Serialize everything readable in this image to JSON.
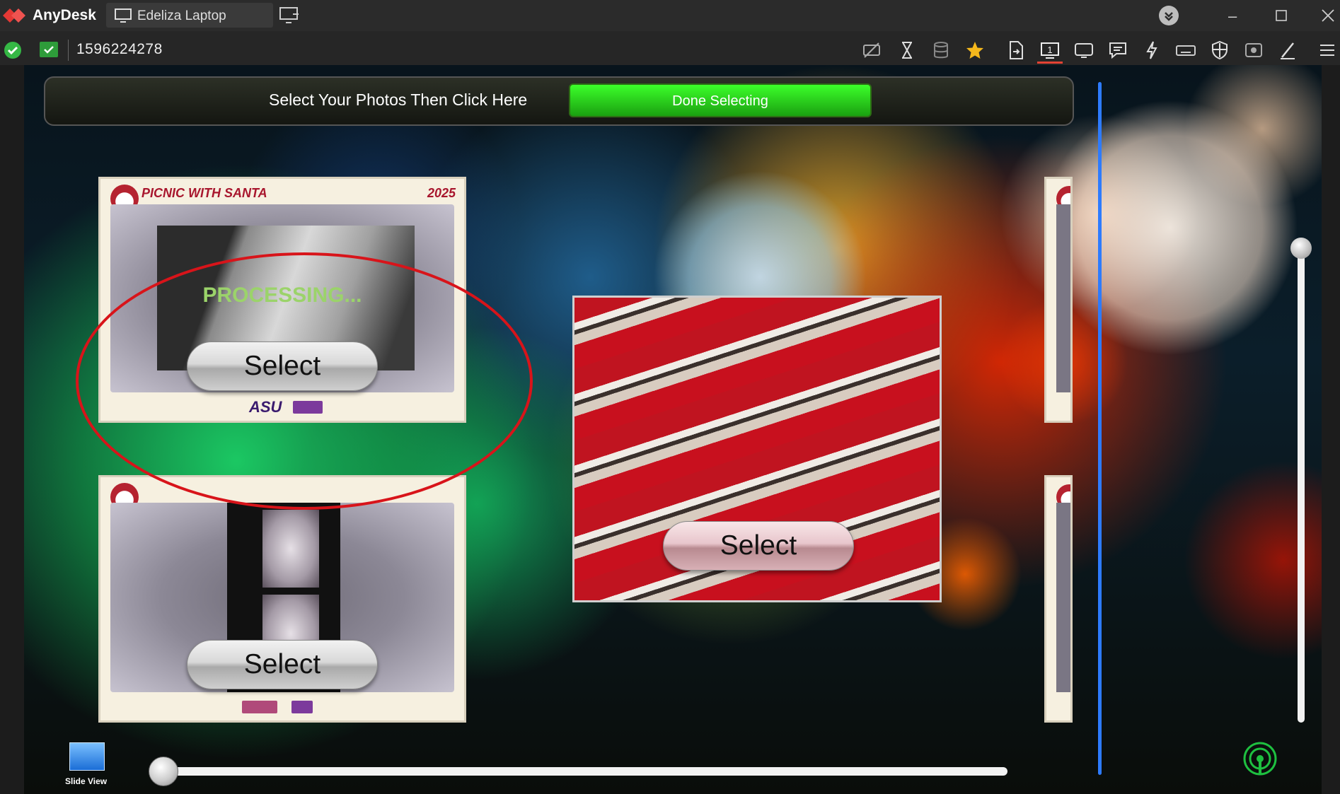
{
  "window": {
    "app_name": "AnyDesk",
    "tab_label": "Edeliza Laptop"
  },
  "address": {
    "remote_id": "1596224278"
  },
  "toolbar_icons": [
    "privacy-icon",
    "hourglass-icon",
    "database-icon",
    "star-icon",
    "file-transfer-icon",
    "monitor-1-icon",
    "display-icon",
    "chat-icon",
    "lightning-icon",
    "keyboard-icon",
    "shield-icon",
    "record-icon",
    "pen-icon",
    "menu-icon"
  ],
  "remote": {
    "instruction": "Select Your Photos Then Click Here",
    "done_button": "Done Selecting",
    "photo1": {
      "header_title": "PICNIC WITH SANTA",
      "header_year": "2025",
      "status": "PROCESSING...",
      "footer_logo": "ASU",
      "select_label": "Select"
    },
    "photo2": {
      "select_label": "Select"
    },
    "featured": {
      "select_label": "Select"
    },
    "slide_view_label": "Slide View"
  },
  "colors": {
    "accent_green": "#1aa010",
    "annotation_red": "#d8141a",
    "divider_blue": "#2d7bff"
  }
}
